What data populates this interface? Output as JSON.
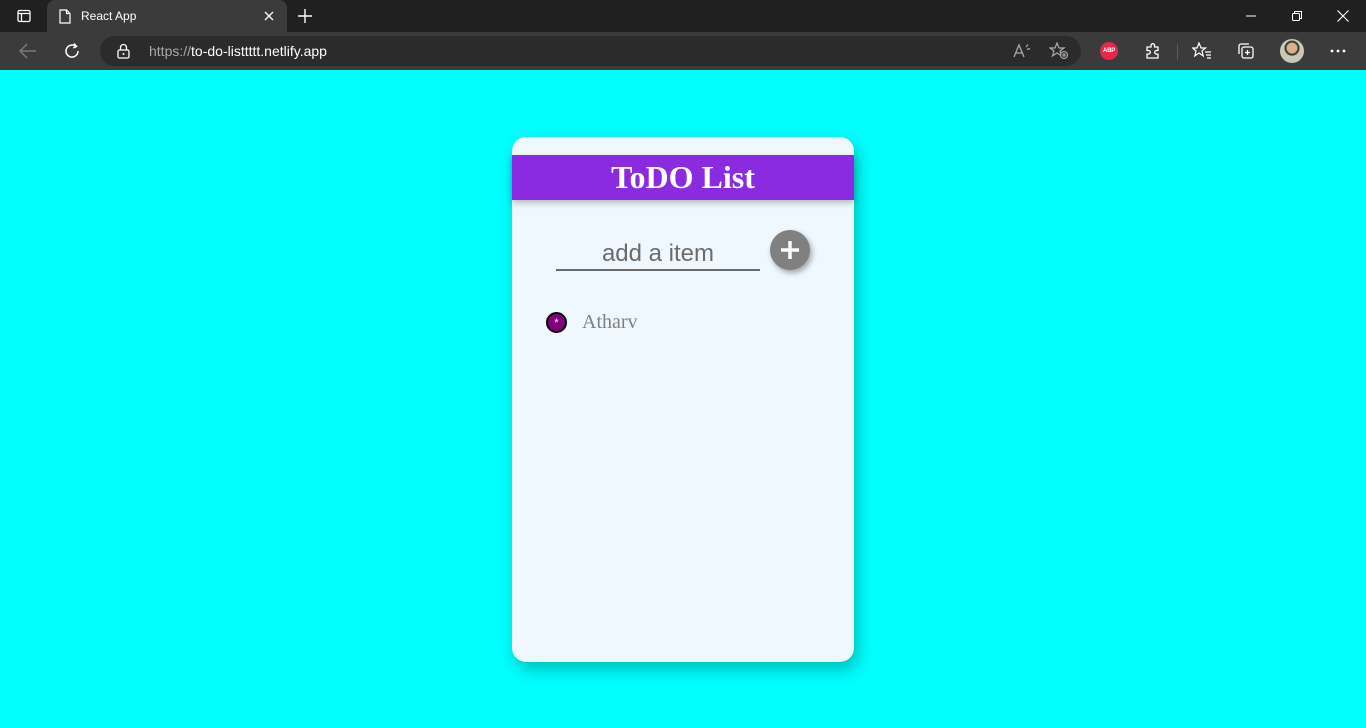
{
  "browser": {
    "tab_title": "React App",
    "url_scheme": "https://",
    "url_host": "to-do-listtttt.netlify.app",
    "extension_badge": "ABP"
  },
  "app": {
    "title": "ToDO List",
    "input_placeholder": "add a item",
    "input_value": "",
    "add_button_label": "+",
    "items": [
      {
        "delete_label": "*",
        "text": "Atharv"
      }
    ]
  },
  "colors": {
    "page_background": "#00ffff",
    "card_background": "#f0f8ff",
    "header_background": "#8a2be2",
    "add_button": "#808080",
    "delete_button": "#800080"
  }
}
